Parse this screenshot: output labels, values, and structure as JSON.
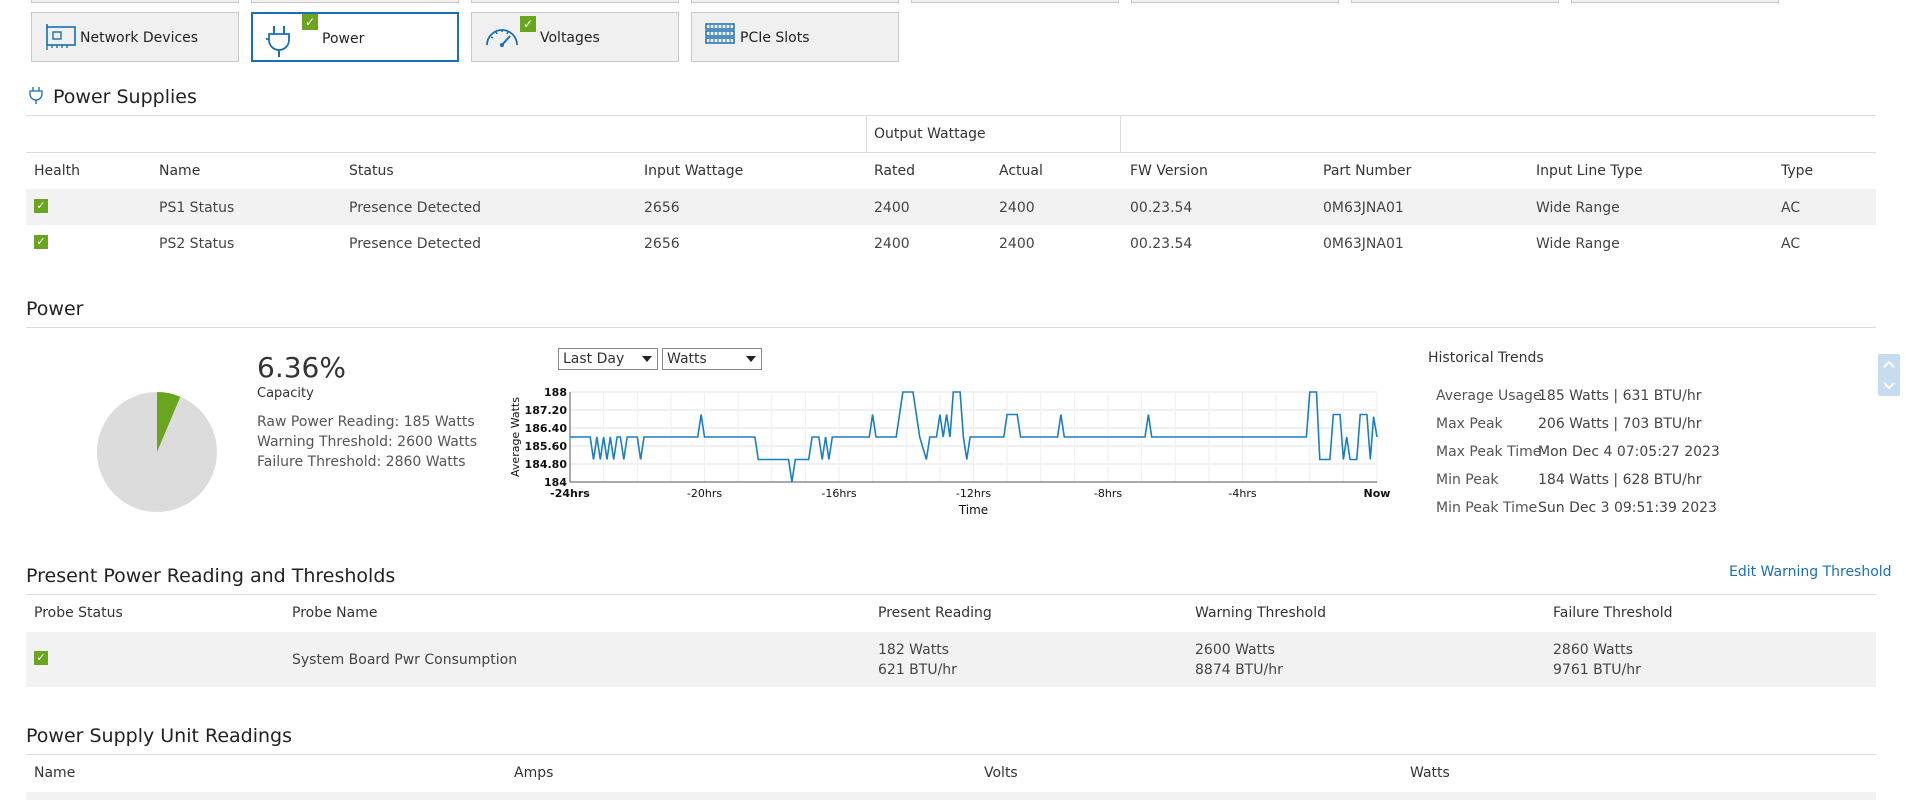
{
  "tabs": [
    {
      "label": "Network Devices",
      "icon": "network-card-icon",
      "checked": false
    },
    {
      "label": "Power",
      "icon": "power-plug-icon",
      "checked": true
    },
    {
      "label": "Voltages",
      "icon": "gauge-icon",
      "checked": true
    },
    {
      "label": "PCIe Slots",
      "icon": "pcie-slots-icon",
      "checked": false
    }
  ],
  "power_supplies": {
    "title": "Power Supplies",
    "group_header": "Output Wattage",
    "columns": [
      "Health",
      "Name",
      "Status",
      "Input Wattage",
      "Rated",
      "Actual",
      "FW Version",
      "Part Number",
      "Input Line Type",
      "Type"
    ],
    "rows": [
      [
        "PS1 Status",
        "Presence Detected",
        "2656",
        "2400",
        "2400",
        "00.23.54",
        "0M63JNA01",
        "Wide Range",
        "AC"
      ],
      [
        "PS2 Status",
        "Presence Detected",
        "2656",
        "2400",
        "2400",
        "00.23.54",
        "0M63JNA01",
        "Wide Range",
        "AC"
      ]
    ]
  },
  "power": {
    "title": "Power",
    "capacity_value": "6.36%",
    "capacity_label": "Capacity",
    "capacity_fraction": 0.0636,
    "raw_reading": "Raw Power Reading: 185 Watts",
    "warning_threshold": "Warning Threshold: 2600 Watts",
    "failure_threshold": "Failure Threshold: 2860 Watts",
    "range_select": "Last Day",
    "unit_select": "Watts",
    "historical": {
      "title": "Historical Trends",
      "items": [
        {
          "label": "Average Usage",
          "value": "185 Watts | 631 BTU/hr"
        },
        {
          "label": "Max Peak",
          "value": "206 Watts | 703 BTU/hr"
        },
        {
          "label": "Max Peak Time",
          "value": "Mon Dec 4 07:05:27 2023"
        },
        {
          "label": "Min Peak",
          "value": "184 Watts | 628 BTU/hr"
        },
        {
          "label": "Min Peak Time",
          "value": "Sun Dec 3 09:51:39 2023"
        }
      ]
    }
  },
  "chart_data": {
    "type": "line",
    "xlabel": "Time",
    "ylabel": "Average Watts",
    "ylim": [
      184,
      188
    ],
    "xlim": [
      -24,
      0
    ],
    "x_ticks": [
      "-24hrs",
      "-20hrs",
      "-16hrs",
      "-12hrs",
      "-8hrs",
      "-4hrs",
      "Now"
    ],
    "y_ticks": [
      "184",
      "184.80",
      "185.60",
      "186.40",
      "187.20",
      "188"
    ],
    "grid": true,
    "series": [
      {
        "color": "#1a7fc1",
        "points": [
          [
            -24,
            186
          ],
          [
            -23.4,
            186
          ],
          [
            -23.3,
            185
          ],
          [
            -23.2,
            186
          ],
          [
            -23.1,
            185
          ],
          [
            -23,
            186
          ],
          [
            -22.9,
            185
          ],
          [
            -22.8,
            186
          ],
          [
            -22.7,
            185
          ],
          [
            -22.6,
            186
          ],
          [
            -22.5,
            186
          ],
          [
            -22.4,
            185
          ],
          [
            -22.3,
            186
          ],
          [
            -22,
            186
          ],
          [
            -21.9,
            185
          ],
          [
            -21.8,
            186
          ],
          [
            -20.2,
            186
          ],
          [
            -20.1,
            187
          ],
          [
            -20,
            186
          ],
          [
            -18.5,
            186
          ],
          [
            -18.4,
            185
          ],
          [
            -17.5,
            185
          ],
          [
            -17.4,
            184
          ],
          [
            -17.3,
            185
          ],
          [
            -16.9,
            185
          ],
          [
            -16.8,
            186
          ],
          [
            -16.6,
            186
          ],
          [
            -16.5,
            185
          ],
          [
            -16.4,
            186
          ],
          [
            -16.3,
            185
          ],
          [
            -16.2,
            186
          ],
          [
            -15.1,
            186
          ],
          [
            -15,
            187
          ],
          [
            -14.9,
            186
          ],
          [
            -14.3,
            186
          ],
          [
            -14.1,
            188
          ],
          [
            -13.8,
            188
          ],
          [
            -13.6,
            186
          ],
          [
            -13.4,
            185
          ],
          [
            -13.3,
            186
          ],
          [
            -13.1,
            186
          ],
          [
            -13,
            187
          ],
          [
            -12.9,
            186
          ],
          [
            -12.8,
            187
          ],
          [
            -12.7,
            186
          ],
          [
            -12.6,
            188
          ],
          [
            -12.4,
            188
          ],
          [
            -12.3,
            186
          ],
          [
            -12.2,
            185
          ],
          [
            -12.1,
            186
          ],
          [
            -11.1,
            186
          ],
          [
            -11,
            187
          ],
          [
            -10.7,
            187
          ],
          [
            -10.6,
            186
          ],
          [
            -9.5,
            186
          ],
          [
            -9.4,
            187
          ],
          [
            -9.3,
            186
          ],
          [
            -6.9,
            186
          ],
          [
            -6.8,
            187
          ],
          [
            -6.7,
            186
          ],
          [
            -2.1,
            186
          ],
          [
            -2,
            188
          ],
          [
            -1.8,
            188
          ],
          [
            -1.7,
            185
          ],
          [
            -1.4,
            185
          ],
          [
            -1.3,
            187
          ],
          [
            -1.1,
            187
          ],
          [
            -1,
            185
          ],
          [
            -0.9,
            186
          ],
          [
            -0.8,
            185
          ],
          [
            -0.6,
            185
          ],
          [
            -0.5,
            187
          ],
          [
            -0.3,
            187
          ],
          [
            -0.2,
            185
          ],
          [
            -0.1,
            186.9
          ],
          [
            0,
            186
          ]
        ]
      }
    ]
  },
  "thresholds": {
    "title": "Present Power Reading and Thresholds",
    "edit_link": "Edit Warning Threshold",
    "columns": [
      "Probe Status",
      "Probe Name",
      "Present Reading",
      "Warning Threshold",
      "Failure Threshold"
    ],
    "row": {
      "name": "System Board Pwr Consumption",
      "present_w": "182 Watts",
      "present_btu": "621 BTU/hr",
      "warn_w": "2600 Watts",
      "warn_btu": "8874 BTU/hr",
      "fail_w": "2860 Watts",
      "fail_btu": "9761 BTU/hr"
    }
  },
  "psu_readings": {
    "title": "Power Supply Unit Readings",
    "columns": [
      "Name",
      "Amps",
      "Volts",
      "Watts"
    ]
  },
  "colors": {
    "accent": "#1a6fb5",
    "ok": "#6aa520",
    "pie_bg": "#dcdcdc",
    "line": "#1a7fc1"
  }
}
